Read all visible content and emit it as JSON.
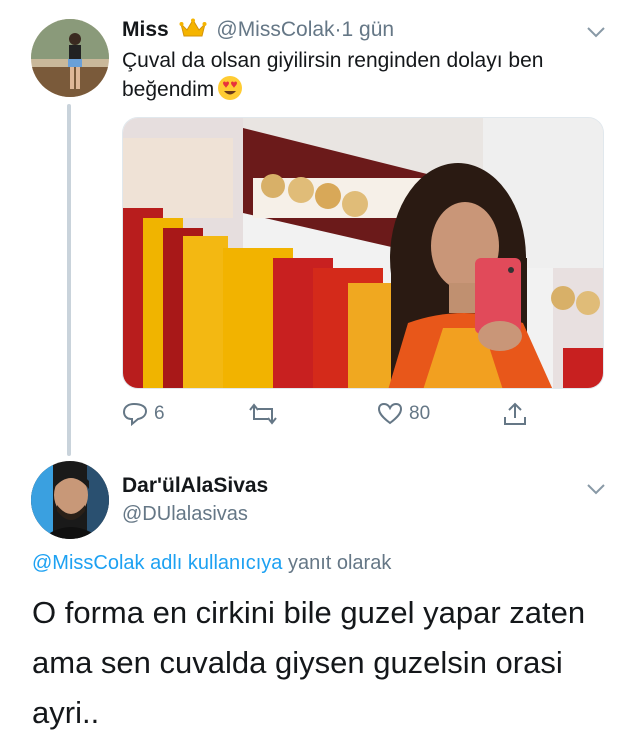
{
  "tweet1": {
    "display_name": "Miss",
    "handle": "@MissColak",
    "separator": "·",
    "time": "1 gün",
    "text": "Çuval da olsan giyilirsin renginden dolayı ben beğendim",
    "name_icon": "crown-emoji",
    "text_emoji": "heart-eyes-emoji",
    "actions": {
      "reply_count": "6",
      "retweet_count": "",
      "like_count": "80"
    }
  },
  "tweet2": {
    "display_name": "Dar'ülAlaSivas",
    "handle": "@DUlalasivas",
    "reply_target": "@MissColak adlı kullanıcıya",
    "reply_suffix": "yanıt olarak",
    "text": "O forma en cirkini bile guzel yapar zaten ama sen cuvalda giysen guzelsin orasi ayri.."
  },
  "colors": {
    "link": "#1da1f2",
    "muted": "#657786",
    "thread_line": "#c9d3db",
    "text": "#14171a"
  }
}
